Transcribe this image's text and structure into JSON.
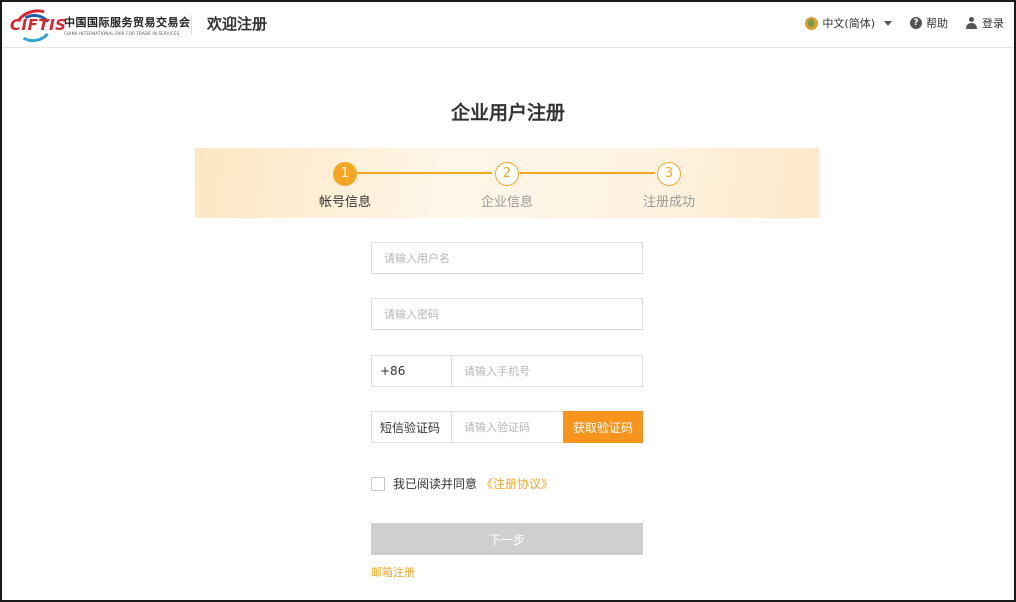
{
  "header": {
    "logo_text": "CIFTIS",
    "logo_cn": "中国国际服务贸易交易会",
    "logo_en": "CHINA INTERNATIONAL FAIR FOR TRADE IN SERVICES",
    "page_heading": "欢迎注册",
    "language": "中文(简体)",
    "help": "帮助",
    "login": "登录"
  },
  "main": {
    "title": "企业用户注册"
  },
  "steps": [
    {
      "number": "1",
      "label": "帐号信息",
      "active": true
    },
    {
      "number": "2",
      "label": "企业信息",
      "active": false
    },
    {
      "number": "3",
      "label": "注册成功",
      "active": false
    }
  ],
  "form": {
    "username_placeholder": "请输入用户名",
    "password_placeholder": "请输入密码",
    "phone_prefix": "+86",
    "phone_placeholder": "请输入手机号",
    "sms_label": "短信验证码",
    "sms_placeholder": "请输入验证码",
    "sms_button": "获取验证码",
    "agree_text": "我已阅读并同意",
    "agree_link": "《注册协议》",
    "next_button": "下一步",
    "email_register": "邮箱注册"
  },
  "colors": {
    "accent": "#f5a623",
    "sms_button": "#f7941d",
    "disabled_button": "#cfcfcf"
  }
}
